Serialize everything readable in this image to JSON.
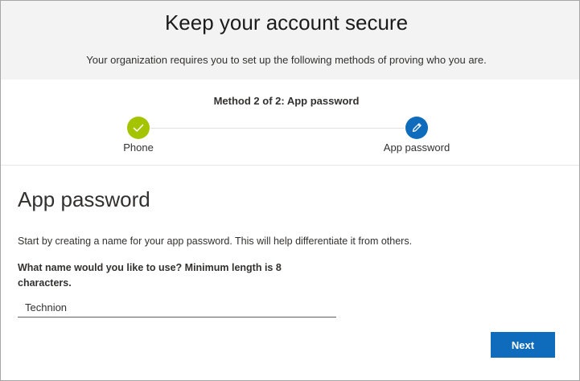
{
  "header": {
    "title": "Keep your account secure",
    "subtitle": "Your organization requires you to set up the following methods of proving who you are."
  },
  "progress": {
    "method_title": "Method 2 of 2: App password",
    "steps": [
      {
        "label": "Phone",
        "status": "complete",
        "icon": "checkmark-icon",
        "color": "#a4c400"
      },
      {
        "label": "App password",
        "status": "current",
        "icon": "pencil-icon",
        "color": "#0f6cbd"
      }
    ]
  },
  "form": {
    "section_title": "App password",
    "description": "Start by creating a name for your app password. This will help differentiate it from others.",
    "field_label": "What name would you like to use? Minimum length is 8 characters.",
    "name_value": "Technion"
  },
  "actions": {
    "next_label": "Next",
    "accent_color": "#0f6cbd"
  }
}
